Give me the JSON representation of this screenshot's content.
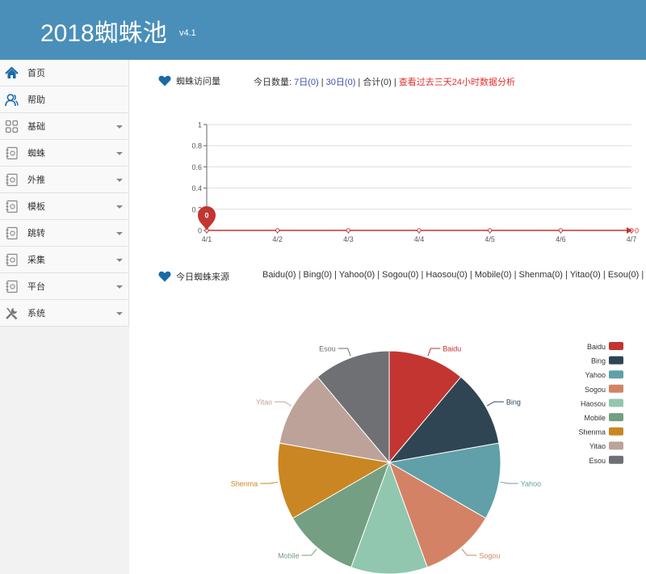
{
  "header": {
    "title": "2018蜘蛛池",
    "version": "v4.1"
  },
  "sidebar": {
    "items": [
      {
        "label": "首页",
        "icon": "home-icon",
        "has_caret": false
      },
      {
        "label": "帮助",
        "icon": "user-help-icon",
        "has_caret": false
      },
      {
        "label": "基础",
        "icon": "grid-icon",
        "has_caret": true
      },
      {
        "label": "蜘蛛",
        "icon": "address-book-icon",
        "has_caret": true
      },
      {
        "label": "外推",
        "icon": "address-book-icon",
        "has_caret": true
      },
      {
        "label": "模板",
        "icon": "address-book-icon",
        "has_caret": true
      },
      {
        "label": "跳转",
        "icon": "address-book-icon",
        "has_caret": true
      },
      {
        "label": "采集",
        "icon": "address-book-icon",
        "has_caret": true
      },
      {
        "label": "平台",
        "icon": "address-book-icon",
        "has_caret": true
      },
      {
        "label": "系统",
        "icon": "tools-icon",
        "has_caret": true
      }
    ]
  },
  "visits": {
    "title": "蜘蛛访问量",
    "today_label": "今日数量:",
    "link_7d": "7日(0)",
    "sep1": "|",
    "link_30d": "30日(0)",
    "sep2": "|",
    "total": "合计(0)",
    "sep3": "|",
    "analysis_link": "查看过去三天24小时数据分析"
  },
  "sources": {
    "title": "今日蜘蛛来源",
    "summary": "Baidu(0) | Bing(0) | Yahoo(0) | Sogou(0) | Haosou(0) | Mobile(0) | Shenma(0) | Yitao(0) | Esou(0) |"
  },
  "colors": {
    "header_bg": "#4a8fb9",
    "accent_blue": "#1a6aa8",
    "line_red": "#c23531"
  },
  "chart_data": [
    {
      "type": "line",
      "x": [
        "4/1",
        "4/2",
        "4/3",
        "4/4",
        "4/5",
        "4/6",
        "4/7"
      ],
      "series": [
        {
          "values": [
            0,
            0,
            0,
            0,
            0,
            0,
            0
          ]
        }
      ],
      "ylim": [
        0,
        1
      ],
      "yticks": [
        "0",
        "0.2",
        "0.4",
        "0.6",
        "0.8",
        "1"
      ],
      "markpoint": "0",
      "end_label": "0",
      "grid": true
    },
    {
      "type": "pie",
      "categories": [
        "Baidu",
        "Bing",
        "Yahoo",
        "Sogou",
        "Haosou",
        "Mobile",
        "Shenma",
        "Yitao",
        "Esou"
      ],
      "values": [
        1,
        1,
        1,
        1,
        1,
        1,
        1,
        1,
        1
      ],
      "colors": [
        "#c23531",
        "#2f4554",
        "#61a0a8",
        "#d48265",
        "#91c7ae",
        "#749f83",
        "#ca8622",
        "#bda29a",
        "#6e7074"
      ],
      "legend": "right"
    }
  ]
}
